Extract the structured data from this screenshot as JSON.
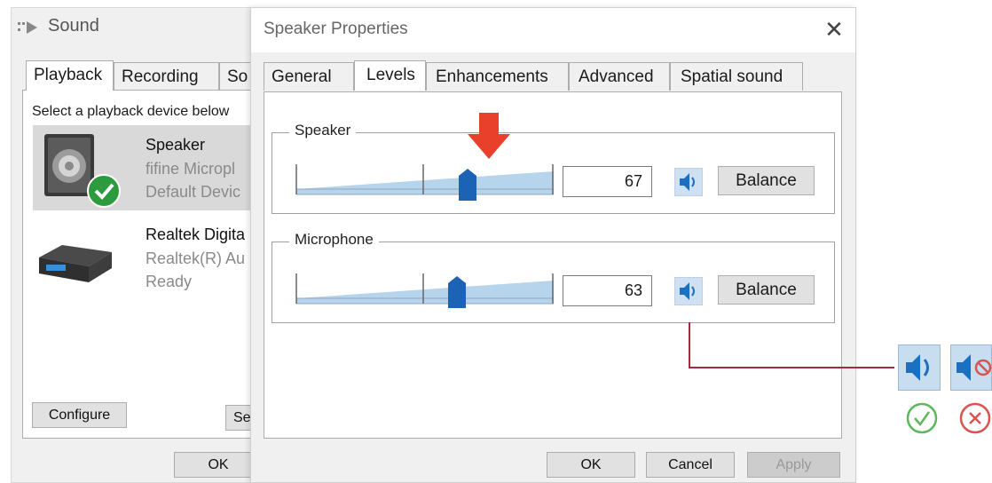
{
  "sound_window": {
    "title": "Sound",
    "tabs": [
      "Playback",
      "Recording",
      "So"
    ],
    "instruction": "Select a playback device below",
    "devices": [
      {
        "name": "Speaker",
        "line1": "fifine Micropl",
        "line2": "Default Devic",
        "selected": true
      },
      {
        "name": "Realtek Digita",
        "line1": "Realtek(R) Au",
        "line2": "Ready",
        "selected": false
      }
    ],
    "configure_label": "Configure",
    "set_default_label": "Se",
    "ok_label": "OK"
  },
  "props_window": {
    "title": "Speaker Properties",
    "close_glyph": "✕",
    "tabs": [
      "General",
      "Levels",
      "Enhancements",
      "Advanced",
      "Spatial sound"
    ],
    "active_tab": "Levels",
    "speaker": {
      "label": "Speaker",
      "value": "67",
      "level": 0.67,
      "balance_label": "Balance"
    },
    "microphone": {
      "label": "Microphone",
      "value": "63",
      "level": 0.63,
      "balance_label": "Balance"
    },
    "ok_label": "OK",
    "cancel_label": "Cancel",
    "apply_label": "Apply"
  },
  "callout": {
    "icons": [
      "speaker-unmuted-icon",
      "speaker-muted-icon"
    ],
    "status_icons": [
      "check-circle-icon",
      "x-circle-icon"
    ],
    "colors": {
      "accent": "#1d6fbf",
      "line": "#a8293f",
      "ok": "#5cb85c",
      "no": "#d9534f",
      "arrow": "#e8402b"
    }
  }
}
